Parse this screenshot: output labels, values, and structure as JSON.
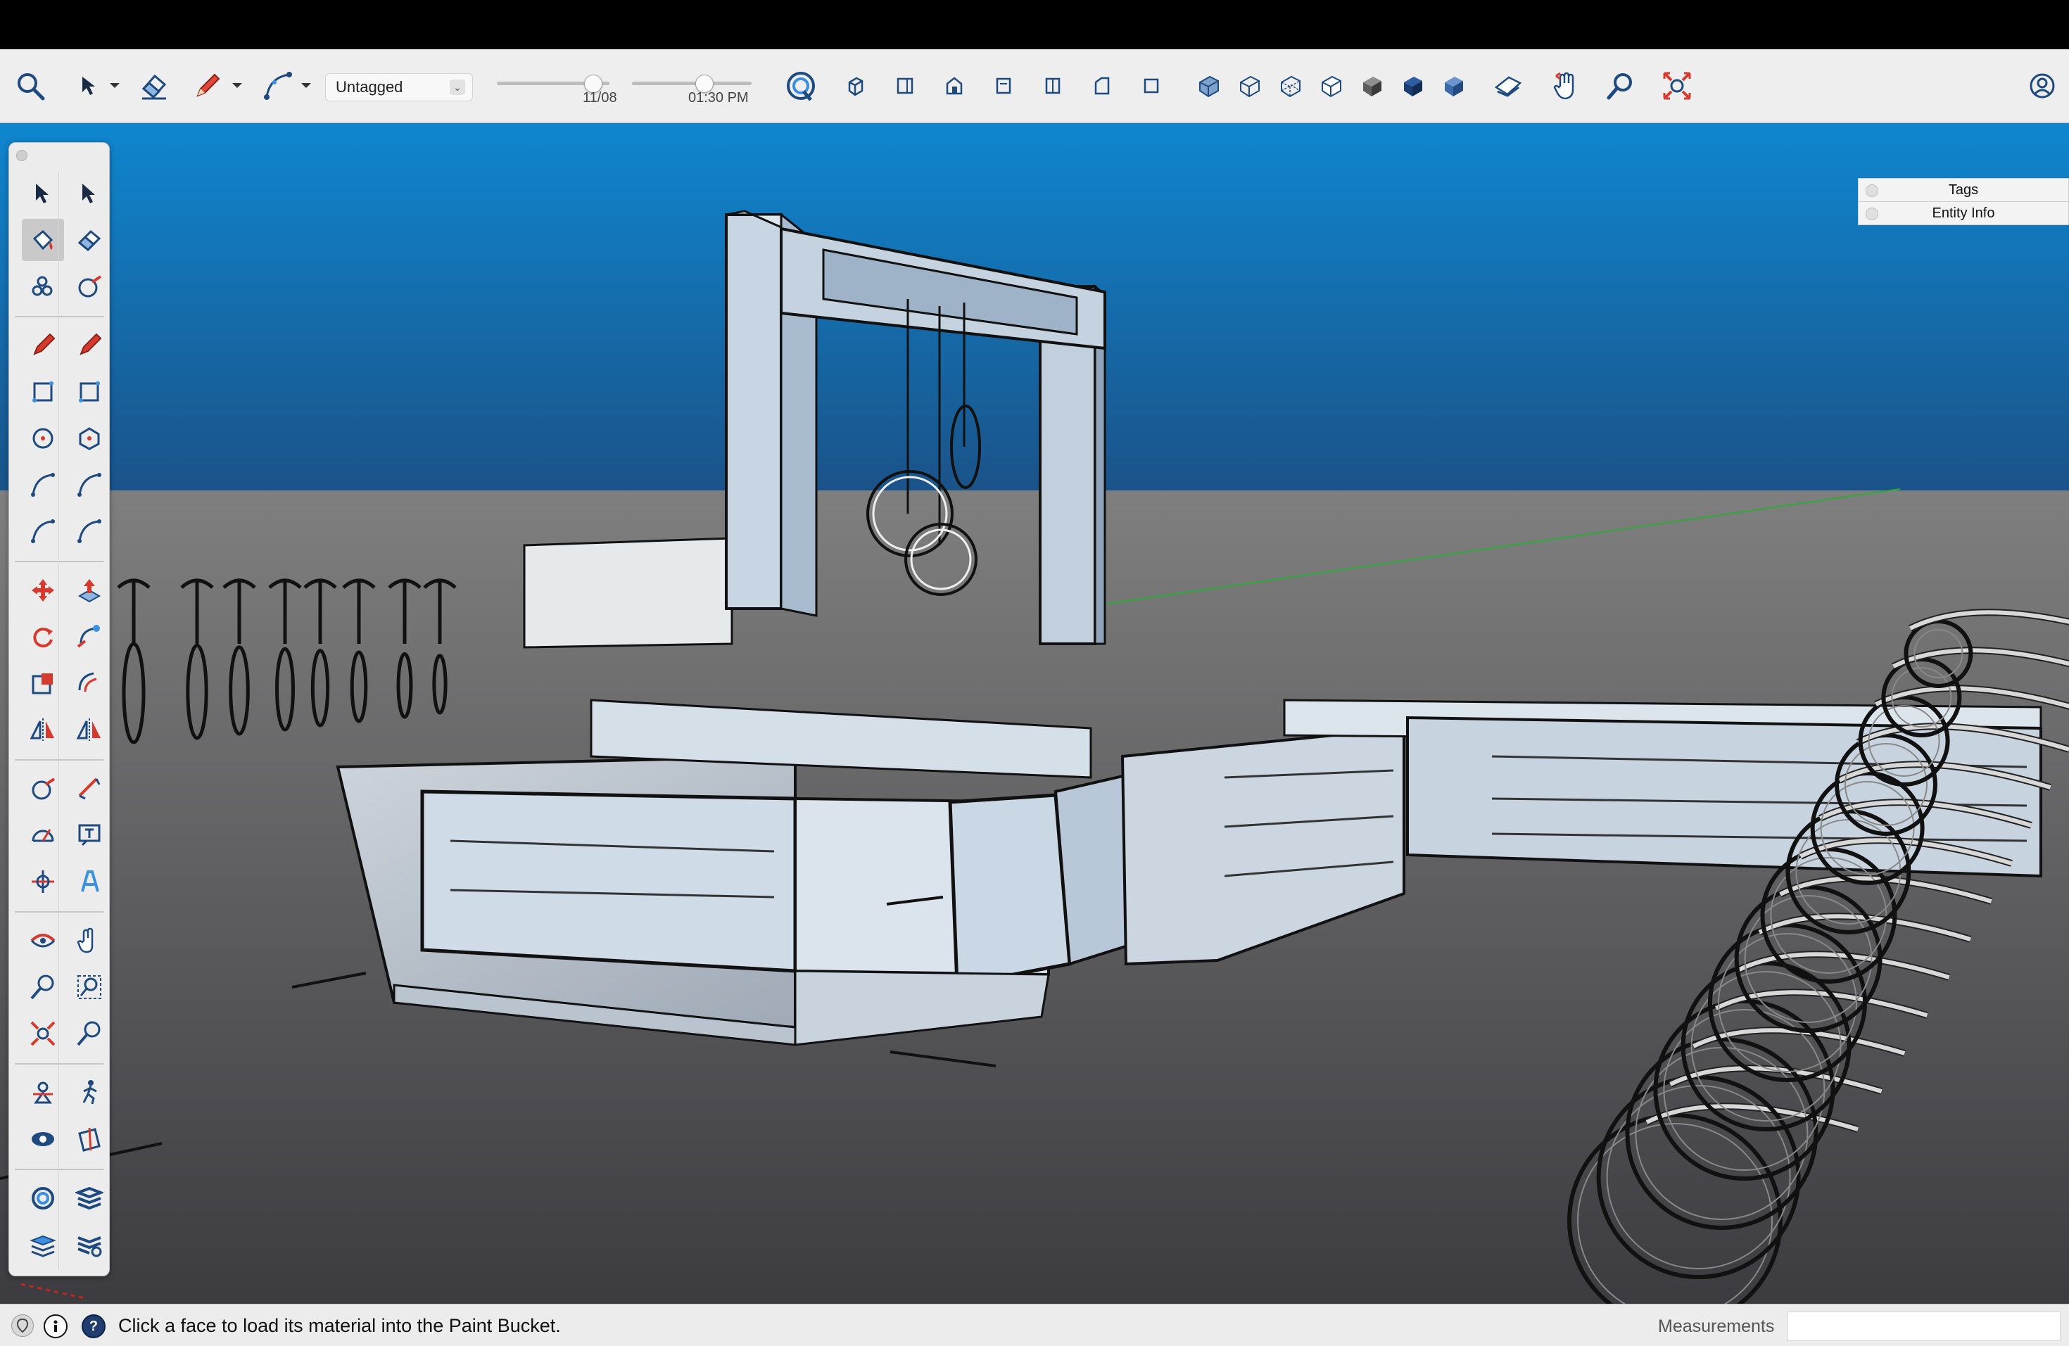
{
  "toolbar": {
    "tag_value": "Untagged",
    "shadow_date": "11/08",
    "shadow_time": "01:30 PM",
    "shadow_date_fraction": 0.85,
    "shadow_time_fraction": 0.6
  },
  "tray": {
    "items": [
      {
        "label": "Tags"
      },
      {
        "label": "Entity Info"
      }
    ]
  },
  "statusbar": {
    "hint": "Click a face to load its material into the Paint Bucket.",
    "measurements_label": "Measurements",
    "measurements_value": ""
  },
  "palette": {
    "active_tool": "paint-bucket",
    "groups": [
      [
        "select-tool",
        "lasso-select-tool",
        "paint-bucket-tool",
        "eraser-tool",
        "tag-tool",
        "tape-measure-tool"
      ],
      [
        "line-tool",
        "freehand-tool",
        "rectangle-tool",
        "rotated-rectangle-tool",
        "circle-tool",
        "polygon-tool",
        "arc-tool",
        "2-point-arc-tool",
        "3-point-arc-tool",
        "pie-tool"
      ],
      [
        "move-tool",
        "push-pull-tool",
        "rotate-tool",
        "follow-me-tool",
        "scale-tool",
        "offset-tool",
        "flip-tool",
        "mirror-tool"
      ],
      [
        "tape-measure-tool",
        "dimension-tool",
        "protractor-tool",
        "text-tool",
        "axes-tool",
        "3d-text-tool"
      ],
      [
        "orbit-tool",
        "pan-tool",
        "zoom-tool",
        "zoom-window-tool",
        "zoom-extents-tool",
        "previous-view-tool"
      ],
      [
        "position-camera-tool",
        "walk-tool",
        "look-around-tool",
        "section-plane-tool"
      ],
      [
        "styles-tool",
        "layers-tool",
        "scenes-tool",
        "settings-tool"
      ]
    ]
  },
  "colors": {
    "sky_top": "#0f78bf",
    "sky_bottom": "#1b5a90",
    "ground_top": "#808080",
    "ground_bottom": "#3e3e3e",
    "toolbar_bg": "#eeeeee",
    "accent_blue": "#1f4d86",
    "accent_red": "#d53a2e"
  }
}
